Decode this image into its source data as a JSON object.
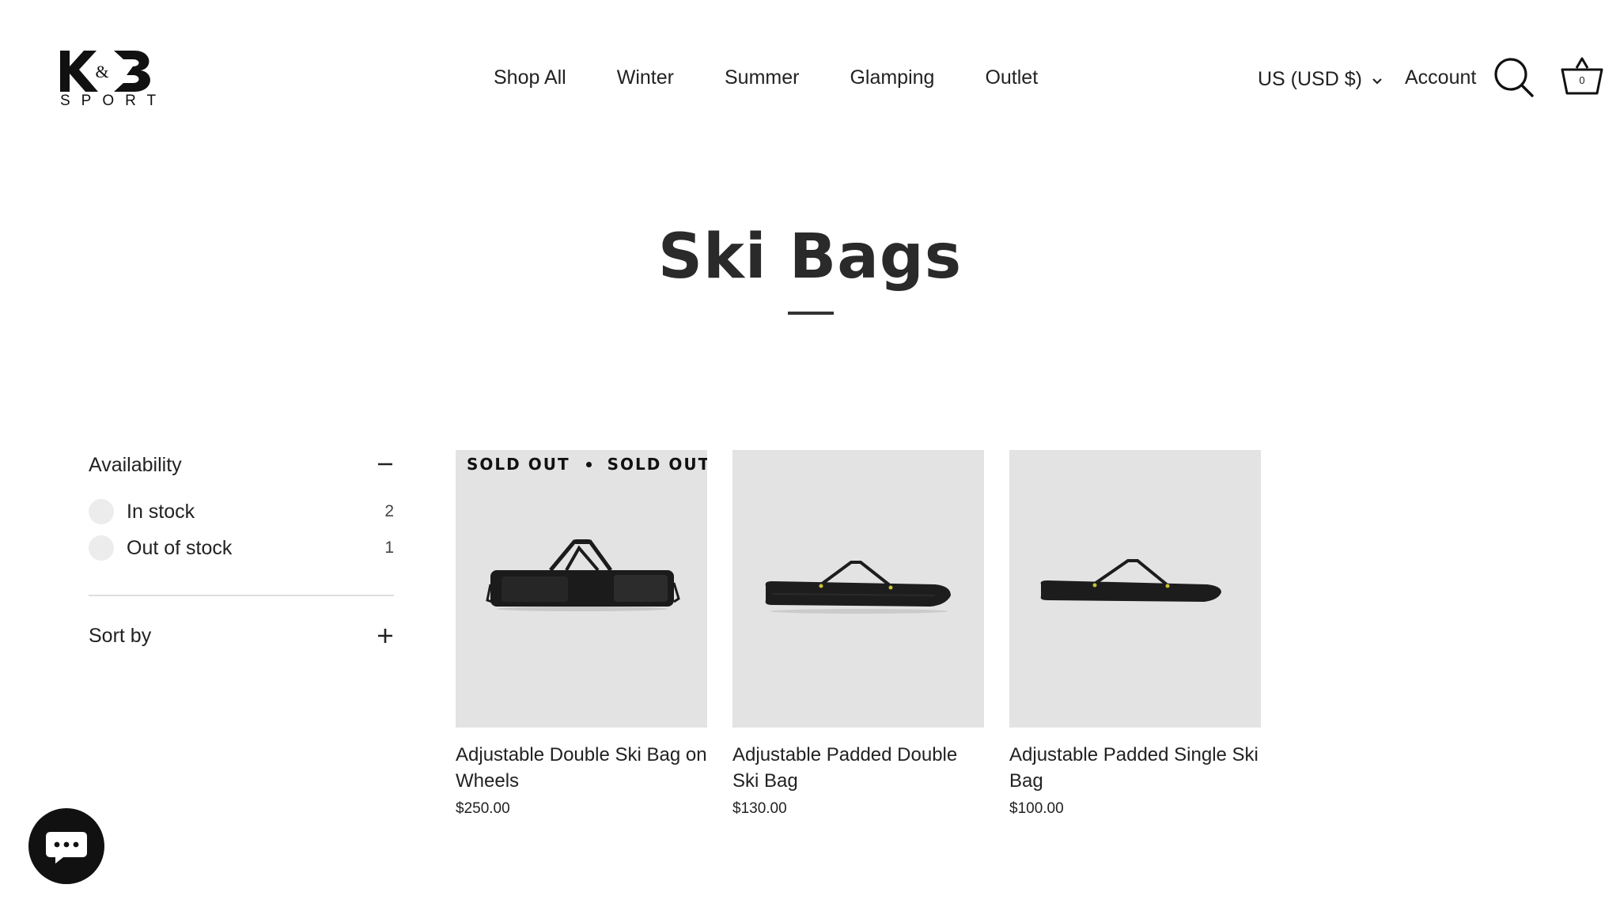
{
  "brand": {
    "mark": "K&B",
    "word": "SPORT"
  },
  "nav": {
    "items": [
      "Shop All",
      "Winter",
      "Summer",
      "Glamping",
      "Outlet"
    ]
  },
  "header": {
    "currency": "US (USD $)",
    "account": "Account",
    "cart_count": "0"
  },
  "page": {
    "title": "Ski Bags"
  },
  "filters": {
    "availability": {
      "title": "Availability",
      "expanded": true,
      "options": [
        {
          "label": "In stock",
          "count": "2"
        },
        {
          "label": "Out of stock",
          "count": "1"
        }
      ]
    },
    "sort": {
      "title": "Sort by",
      "expanded": false
    }
  },
  "products": [
    {
      "name": "Adjustable Double Ski Bag on Wheels",
      "price": "$250.00",
      "badge": "SOLD OUT"
    },
    {
      "name": "Adjustable Padded Double Ski Bag",
      "price": "$130.00"
    },
    {
      "name": "Adjustable Padded Single Ski Bag",
      "price": "$100.00"
    }
  ],
  "colors": {
    "tile": "#e3e3e3",
    "text": "#222222",
    "chat": "#111111"
  },
  "icons": {
    "search": "search-icon",
    "cart": "basket-icon",
    "currency_toggle": "chevron-down-icon",
    "collapse": "minus-icon",
    "expand": "plus-icon",
    "chat": "chat-icon"
  }
}
